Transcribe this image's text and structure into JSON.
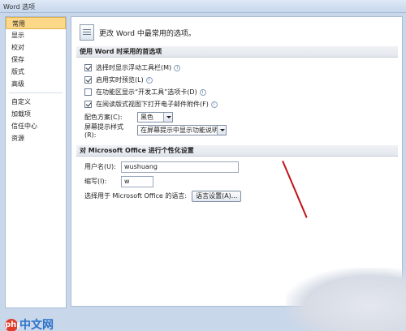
{
  "window": {
    "title": "Word 选项"
  },
  "sidebar": {
    "items": [
      {
        "label": "常用",
        "active": true
      },
      {
        "label": "显示"
      },
      {
        "label": "校对"
      },
      {
        "label": "保存"
      },
      {
        "label": "版式"
      },
      {
        "label": "高级"
      },
      {
        "label": "自定义"
      },
      {
        "label": "加载项"
      },
      {
        "label": "信任中心"
      },
      {
        "label": "资源"
      }
    ]
  },
  "main": {
    "header": "更改 Word 中最常用的选项。",
    "section1": {
      "title": "使用 Word 时采用的首选项",
      "options": [
        {
          "label": "选择时显示浮动工具栏(M)",
          "checked": true
        },
        {
          "label": "启用实时预览(L)",
          "checked": true
        },
        {
          "label": "在功能区显示“开发工具”选项卡(D)",
          "checked": false
        },
        {
          "label": "在阅读版式视图下打开电子邮件附件(F)",
          "checked": true
        }
      ],
      "color_scheme_label": "配色方案(C):",
      "color_scheme_value": "黑色",
      "screentip_label": "屏幕提示样式(R):",
      "screentip_value": "在屏幕提示中显示功能说明"
    },
    "section2": {
      "title": "对 Microsoft Office 进行个性化设置",
      "username_label": "用户名(U):",
      "username_value": "wushuang",
      "initials_label": "缩写(I):",
      "initials_value": "w",
      "language_label": "选择用于 Microsoft Office 的语言:",
      "language_button": "语言设置(A)..."
    }
  },
  "watermark": {
    "badge": "php",
    "text": "中文网"
  },
  "colors": {
    "selection": "#fdd889",
    "annotation_line": "#c1121a",
    "watermark_blue": "#2a72c9"
  }
}
